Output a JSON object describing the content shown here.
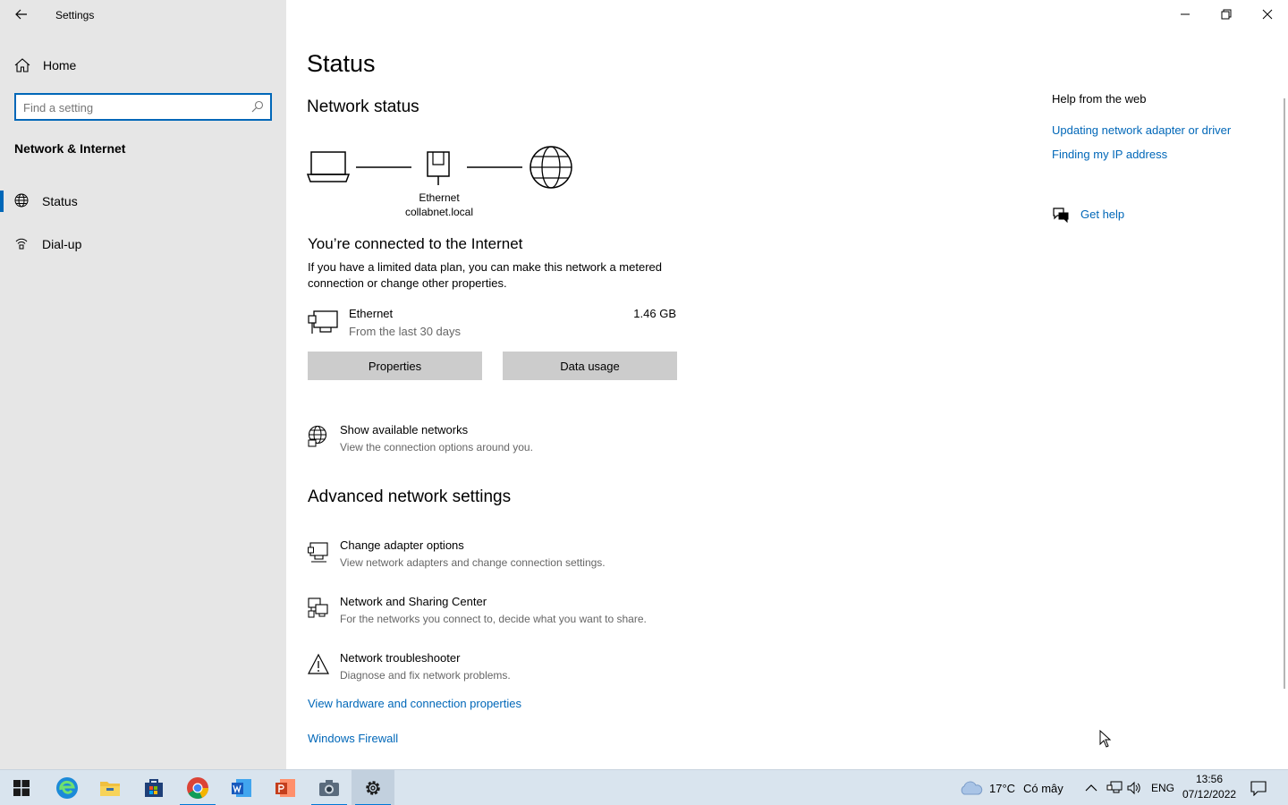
{
  "window": {
    "title": "Settings",
    "controls": [
      "minimize",
      "restore",
      "close"
    ]
  },
  "sidebar": {
    "home_label": "Home",
    "search_placeholder": "Find a setting",
    "category": "Network & Internet",
    "items": [
      {
        "label": "Status",
        "icon": "globe-icon",
        "active": true
      },
      {
        "label": "Dial-up",
        "icon": "dialup-icon",
        "active": false
      }
    ]
  },
  "main": {
    "page_title": "Status",
    "network_status_title": "Network status",
    "diagram": {
      "adapter_label": "Ethernet",
      "domain_label": "collabnet.local"
    },
    "connected_title": "You’re connected to the Internet",
    "connected_desc": "If you have a limited data plan, you can make this network a metered connection or change other properties.",
    "ethernet": {
      "name": "Ethernet",
      "period": "From the last 30 days",
      "usage": "1.46 GB"
    },
    "buttons": {
      "properties": "Properties",
      "data_usage": "Data usage"
    },
    "show_networks": {
      "title": "Show available networks",
      "desc": "View the connection options around you."
    },
    "advanced_title": "Advanced network settings",
    "advanced_options": [
      {
        "title": "Change adapter options",
        "desc": "View network adapters and change connection settings.",
        "icon": "adapter-icon"
      },
      {
        "title": "Network and Sharing Center",
        "desc": "For the networks you connect to, decide what you want to share.",
        "icon": "sharing-icon"
      },
      {
        "title": "Network troubleshooter",
        "desc": "Diagnose and fix network problems.",
        "icon": "warning-icon"
      }
    ],
    "links": {
      "hardware": "View hardware and connection properties",
      "firewall": "Windows Firewall"
    }
  },
  "help": {
    "title": "Help from the web",
    "links": [
      "Updating network adapter or driver",
      "Finding my IP address"
    ],
    "get_help": "Get help"
  },
  "taskbar": {
    "apps": [
      "start",
      "edge",
      "file-explorer",
      "store",
      "chrome",
      "word",
      "powerpoint",
      "camera",
      "settings"
    ],
    "weather_temp": "17°C",
    "weather_desc": "Có mây",
    "language": "ENG",
    "time": "13:56",
    "date": "07/12/2022"
  },
  "colors": {
    "accent": "#0067b8",
    "sidebar_bg": "#e6e6e6",
    "taskbar_bg": "#d9e4ee",
    "button_bg": "#cccccc"
  }
}
